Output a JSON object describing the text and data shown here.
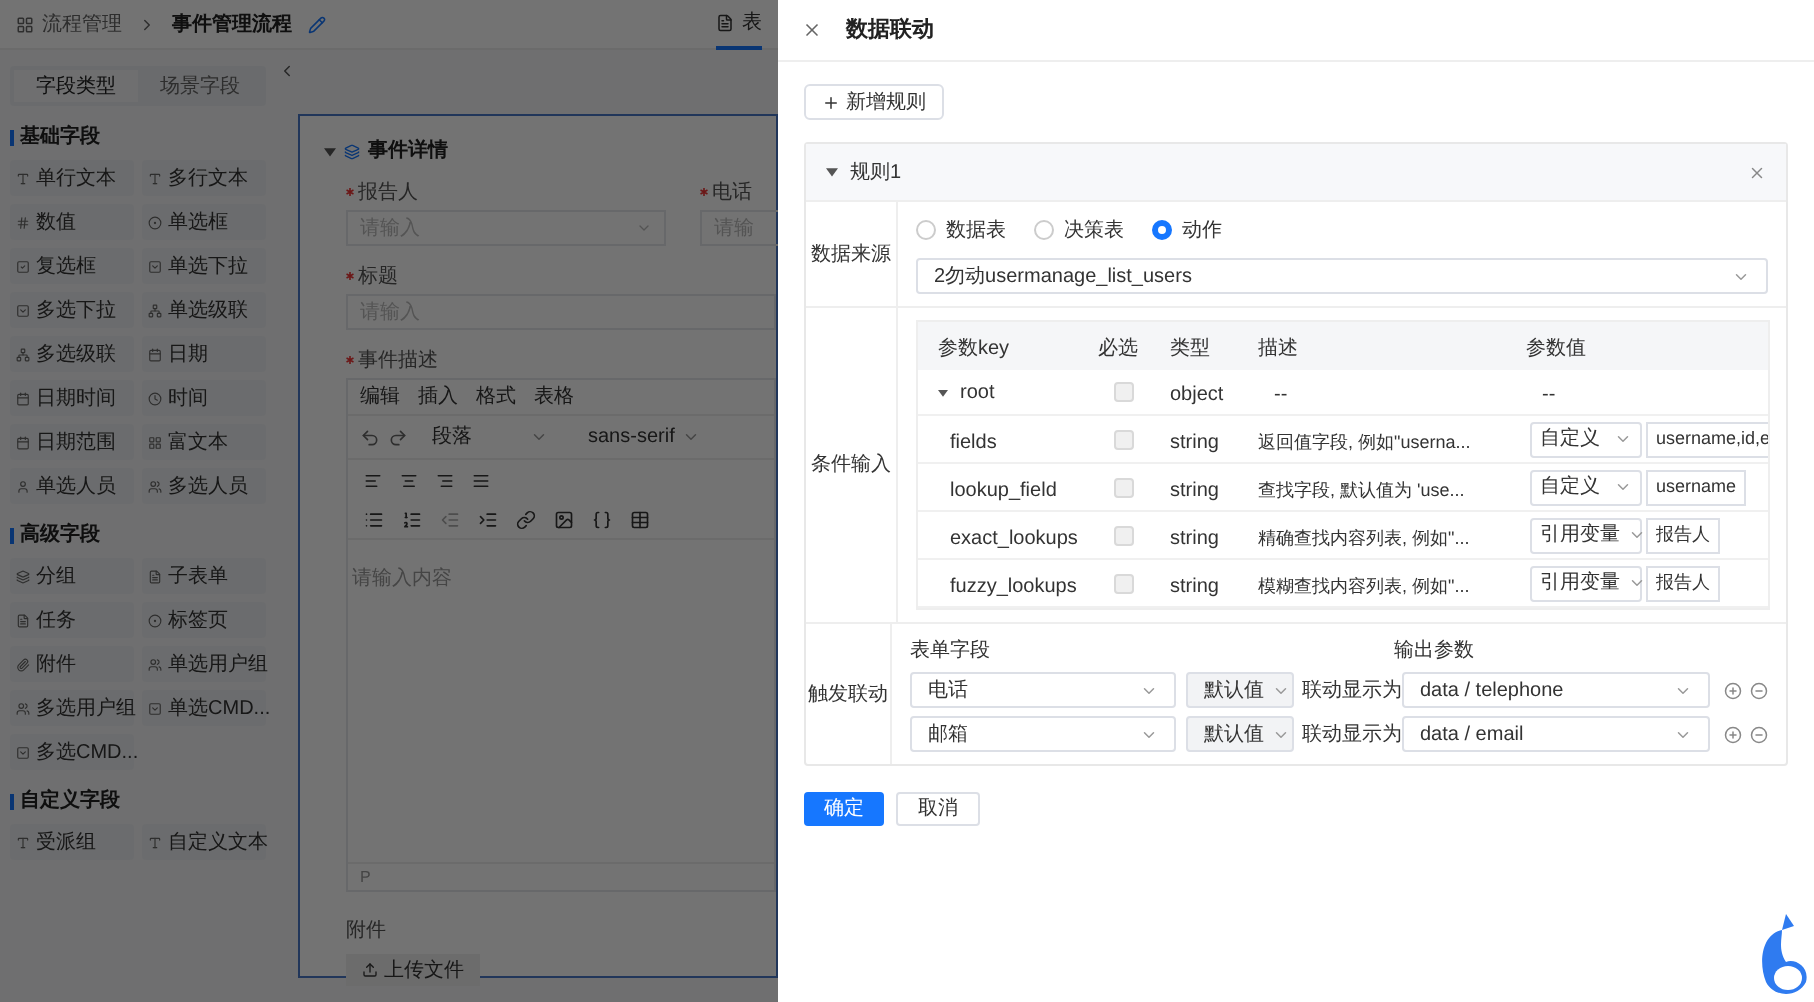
{
  "breadcrumb": {
    "parent": "流程管理",
    "current": "事件管理流程"
  },
  "top_tab": {
    "label": "表",
    "selected": true
  },
  "sidebar": {
    "tabs": [
      {
        "label": "字段类型",
        "selected": true
      },
      {
        "label": "场景字段",
        "selected": false
      }
    ],
    "groups": [
      {
        "title": "基础字段",
        "items": [
          {
            "label": "单行文本"
          },
          {
            "label": "多行文本"
          },
          {
            "label": "数值"
          },
          {
            "label": "单选框"
          },
          {
            "label": "复选框"
          },
          {
            "label": "单选下拉"
          },
          {
            "label": "多选下拉"
          },
          {
            "label": "单选级联"
          },
          {
            "label": "多选级联"
          },
          {
            "label": "日期"
          },
          {
            "label": "日期时间"
          },
          {
            "label": "时间"
          },
          {
            "label": "日期范围"
          },
          {
            "label": "富文本"
          },
          {
            "label": "单选人员"
          },
          {
            "label": "多选人员"
          }
        ]
      },
      {
        "title": "高级字段",
        "items": [
          {
            "label": "分组"
          },
          {
            "label": "子表单"
          },
          {
            "label": "任务"
          },
          {
            "label": "标签页"
          },
          {
            "label": "附件"
          },
          {
            "label": "单选用户组"
          },
          {
            "label": "多选用户组"
          },
          {
            "label": "单选CMD..."
          },
          {
            "label": "多选CMD..."
          }
        ]
      },
      {
        "title": "自定义字段",
        "items": [
          {
            "label": "受派组"
          },
          {
            "label": "自定义文本"
          }
        ]
      }
    ]
  },
  "form": {
    "section": {
      "title": "事件详情",
      "expanded": true
    },
    "fields": [
      {
        "label": "报告人",
        "required": true,
        "placeholder": "请输入"
      },
      {
        "label": "电话",
        "required": true,
        "placeholder": "请输"
      }
    ],
    "title_field": {
      "label": "标题",
      "required": true,
      "placeholder": "请输入"
    },
    "editor": {
      "label": "事件描述",
      "required": true,
      "menus": [
        "编辑",
        "插入",
        "格式",
        "表格"
      ],
      "block": "段落",
      "font": "sans-serif",
      "placeholder": "请输入内容",
      "status": "P"
    },
    "attachment": {
      "label": "附件",
      "button": "上传文件"
    }
  },
  "drawer": {
    "title": "数据联动",
    "add_button": "新增规则",
    "rule": {
      "title": "规则1",
      "expanded": true,
      "source": {
        "label": "数据来源",
        "options": [
          {
            "label": "数据表",
            "selected": false
          },
          {
            "label": "决策表",
            "selected": false
          },
          {
            "label": "动作",
            "selected": true
          }
        ],
        "value": "2勿动usermanage_list_users"
      },
      "condition": {
        "label": "条件输入",
        "columns": [
          "参数key",
          "必选",
          "类型",
          "描述",
          "参数值"
        ],
        "rows": [
          {
            "key": "root",
            "checked": false,
            "type": "object",
            "desc": "--",
            "value": "--",
            "expanded": true,
            "children": [
              {
                "key": "fields",
                "checked": false,
                "type": "string",
                "desc": "返回值字段, 例如\"userna...",
                "mode": "自定义",
                "value": "username,id,e"
              },
              {
                "key": "lookup_field",
                "checked": false,
                "type": "string",
                "desc": "查找字段, 默认值为 'use...",
                "mode": "自定义",
                "value": "username"
              },
              {
                "key": "exact_lookups",
                "checked": false,
                "type": "string",
                "desc": "精确查找内容列表, 例如\"...",
                "mode": "引用变量",
                "value": "报告人"
              },
              {
                "key": "fuzzy_lookups",
                "checked": false,
                "type": "string",
                "desc": "模糊查找内容列表, 例如\"...",
                "mode": "引用变量",
                "value": "报告人"
              }
            ]
          }
        ]
      },
      "trigger": {
        "label": "触发联动",
        "field_header": "表单字段",
        "output_header": "输出参数",
        "rows": [
          {
            "field": "电话",
            "default": "默认值",
            "show_as": "联动显示为",
            "output": "data / telephone"
          },
          {
            "field": "邮箱",
            "default": "默认值",
            "show_as": "联动显示为",
            "output": "data / email"
          }
        ]
      }
    },
    "buttons": [
      {
        "label": "确定",
        "kind": "primary"
      },
      {
        "label": "取消",
        "kind": "default"
      }
    ]
  }
}
